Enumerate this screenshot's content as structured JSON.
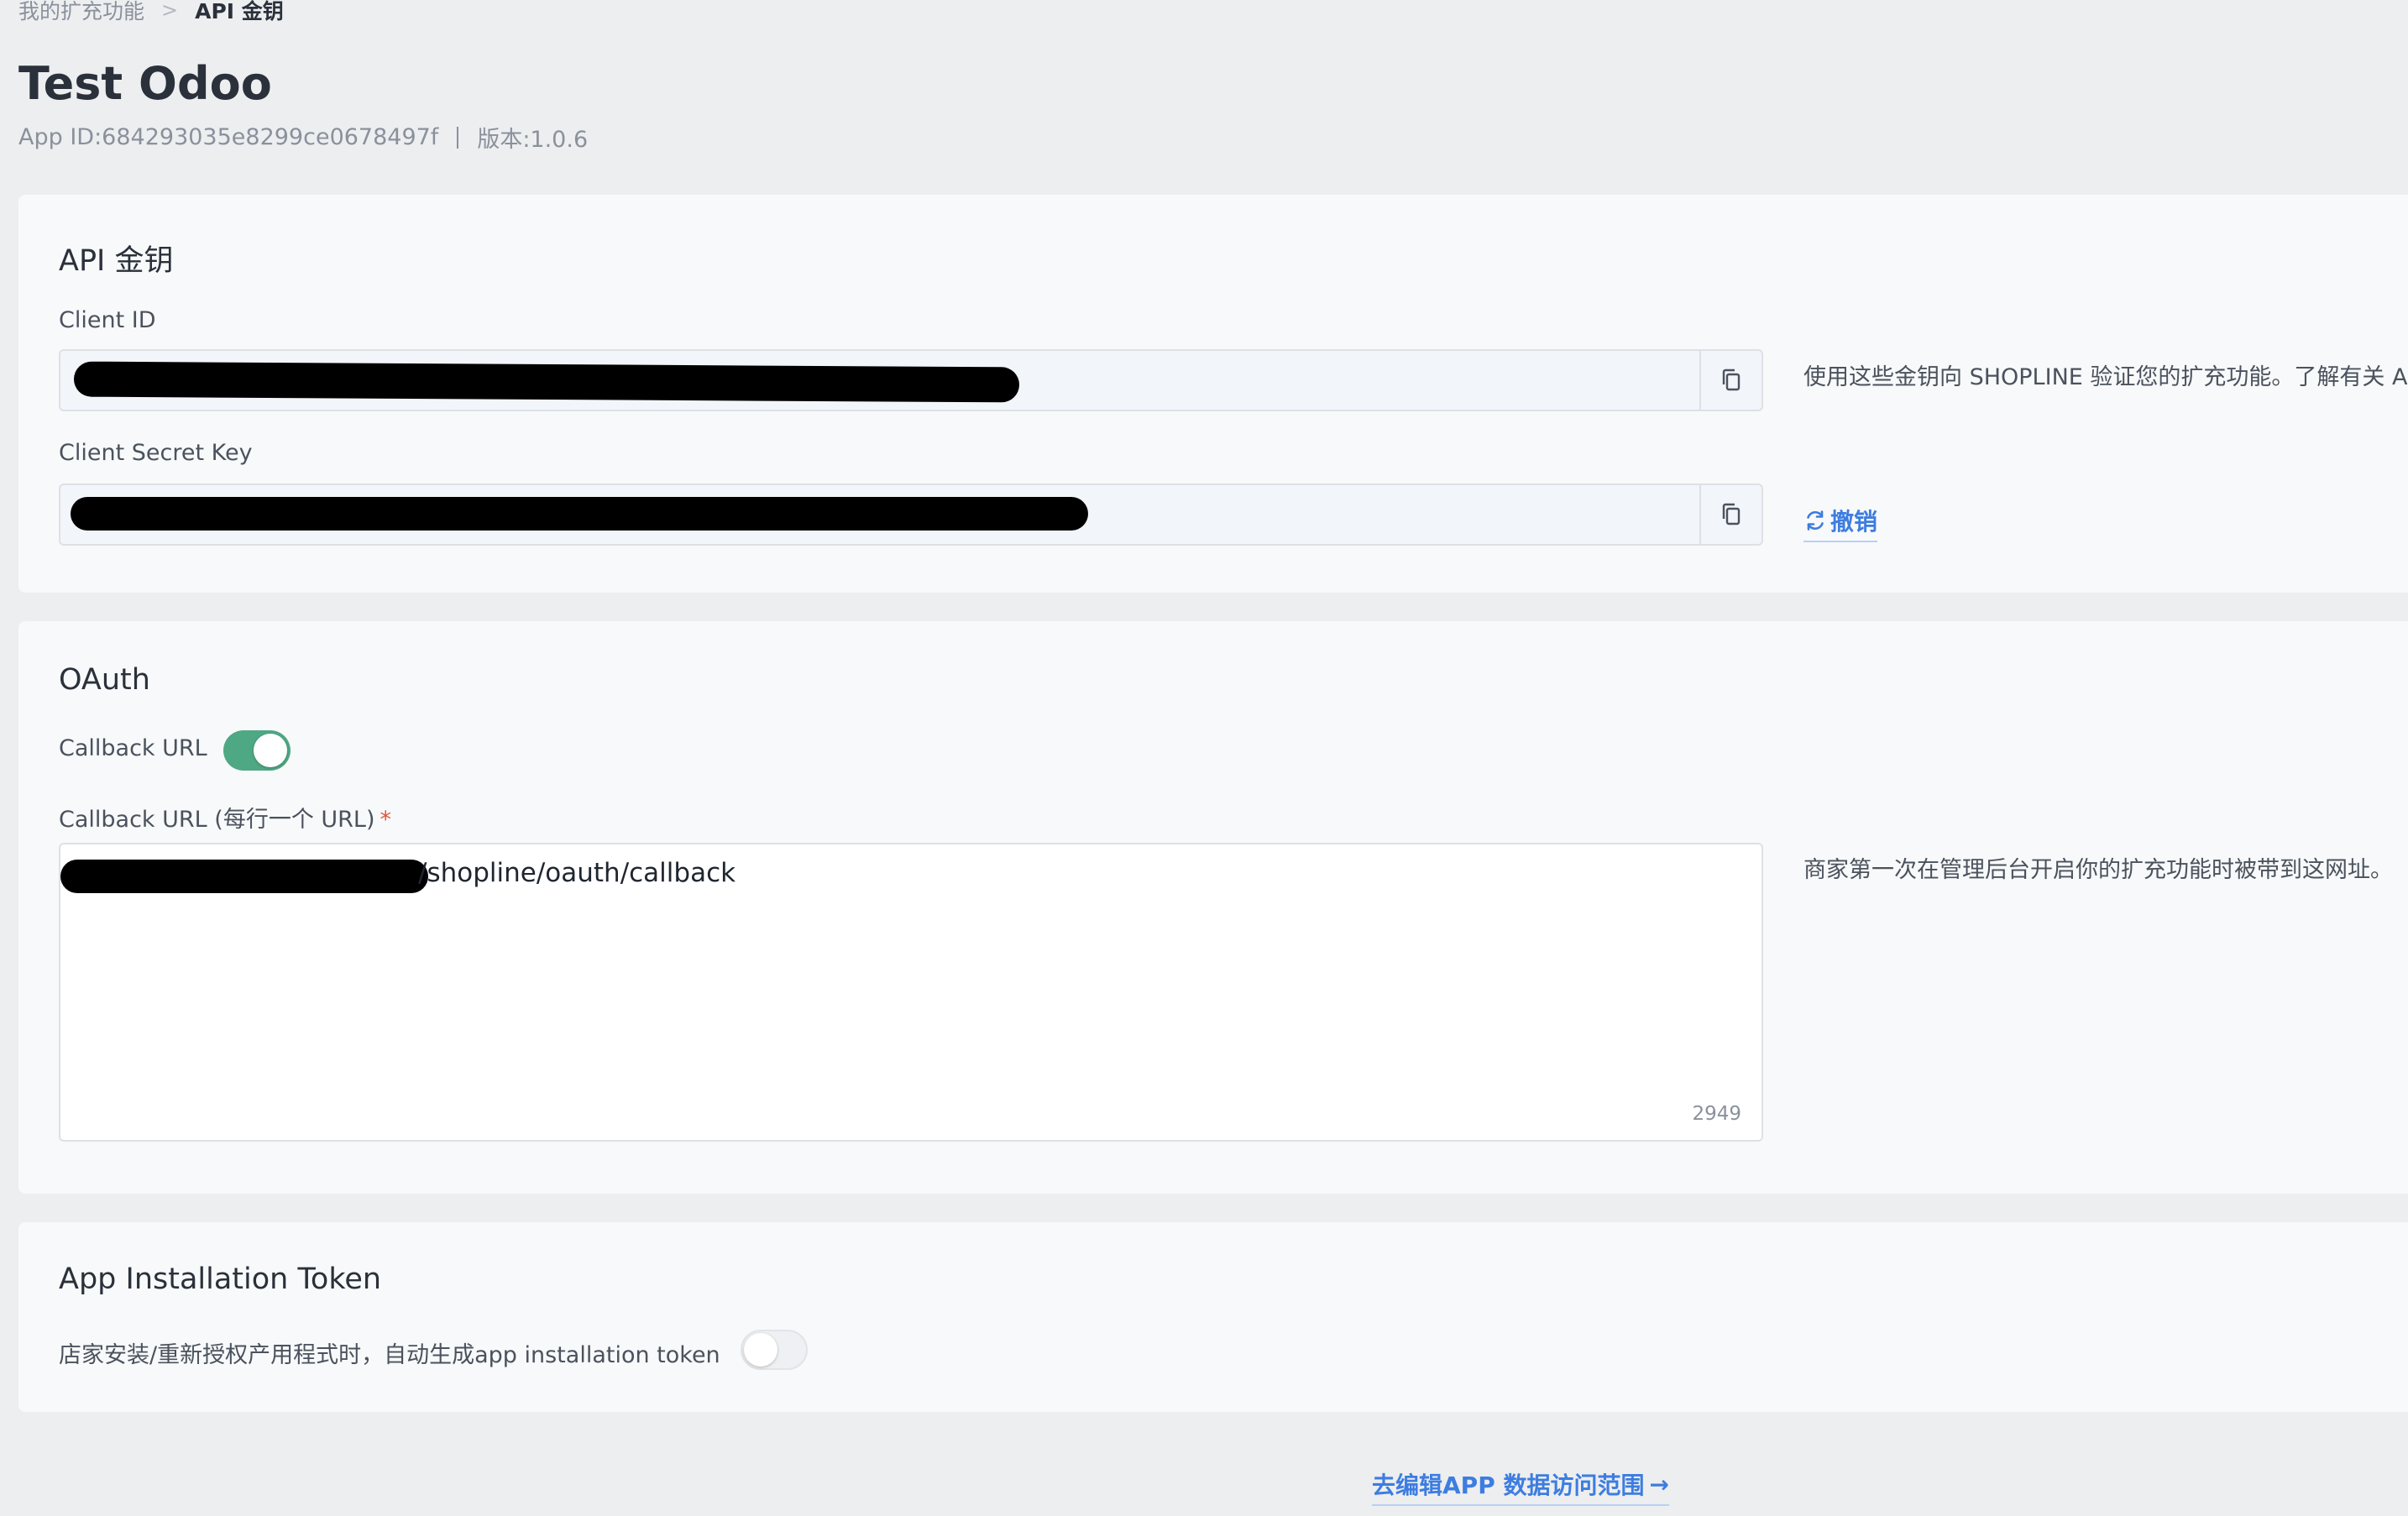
{
  "breadcrumb": {
    "parent": "我的扩充功能",
    "separator": ">",
    "current": "API 金钥"
  },
  "app": {
    "title": "Test Odoo",
    "app_id": "App ID:684293035e8299ce0678497f",
    "version": "版本:1.0.6"
  },
  "api_keys": {
    "title": "API 金钥",
    "client_id_label": "Client ID",
    "client_secret_label": "Client Secret Key",
    "note": "使用这些金钥向 SHOPLINE 验证您的扩充功能。了解有关 API",
    "revoke_label": "撤销",
    "copy_icon": "copy-icon",
    "refresh_icon": "refresh-icon"
  },
  "oauth": {
    "title": "OAuth",
    "callback_toggle_label": "Callback URL",
    "callback_toggle_on": true,
    "callback_field_label": "Callback URL (每行一个 URL)",
    "required_mark": "*",
    "callback_value_suffix": "/shopline/oauth/callback",
    "char_count": "2949",
    "note": "商家第一次在管理后台开启你的扩充功能时被带到这网址。"
  },
  "token": {
    "title": "App Installation Token",
    "label": "店家安装/重新授权产用程式时，自动生成app installation token",
    "toggle_on": false
  },
  "footer": {
    "link_label": "去编辑APP 数据访问范围",
    "arrow": "→"
  },
  "colors": {
    "accent": "#3d7de0",
    "toggle_on": "#4fa884",
    "required": "#e5533d"
  }
}
